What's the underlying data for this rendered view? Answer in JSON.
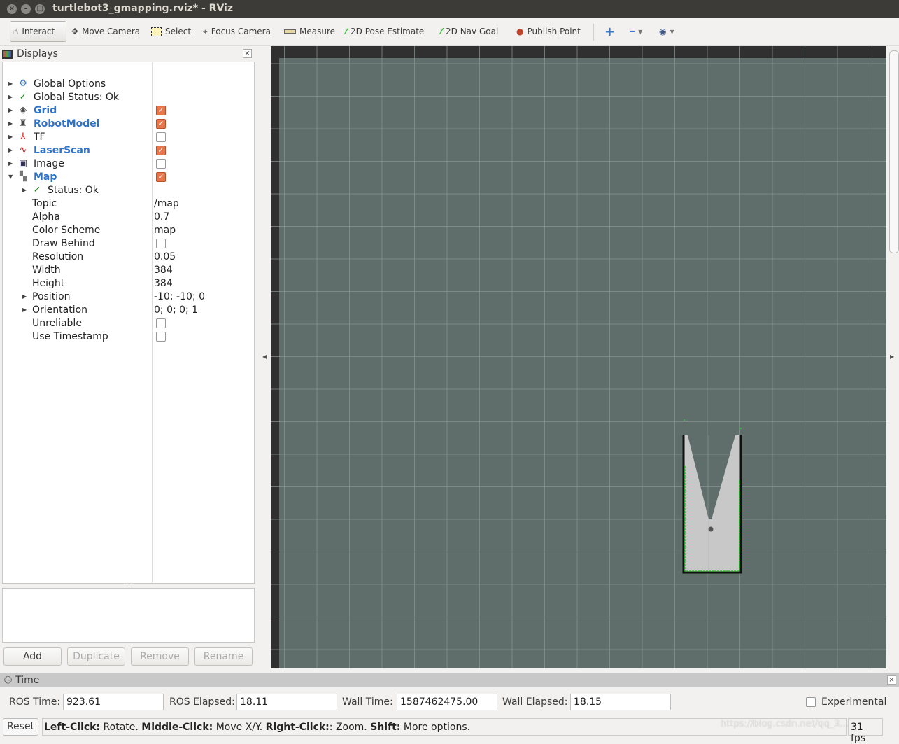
{
  "window": {
    "title": "turtlebot3_gmapping.rviz* - RViz"
  },
  "toolbar": {
    "tools": [
      {
        "label": "Interact",
        "icon": "hand-pointer-icon"
      },
      {
        "label": "Move Camera",
        "icon": "move-arrows-icon"
      },
      {
        "label": "Select",
        "icon": "select-box-icon"
      },
      {
        "label": "Focus Camera",
        "icon": "crosshair-icon"
      },
      {
        "label": "Measure",
        "icon": "ruler-icon"
      },
      {
        "label": "2D Pose Estimate",
        "icon": "green-arrow-icon"
      },
      {
        "label": "2D Nav Goal",
        "icon": "green-arrow-icon"
      },
      {
        "label": "Publish Point",
        "icon": "map-pin-icon"
      }
    ],
    "active": "Interact"
  },
  "displays": {
    "title": "Displays",
    "items": [
      {
        "label": "Global Options",
        "icon": "gear-icon"
      },
      {
        "label": "Global Status: Ok",
        "icon": "check-icon"
      },
      {
        "label": "Grid",
        "icon": "grid-icon",
        "checked": true
      },
      {
        "label": "RobotModel",
        "icon": "robot-icon",
        "checked": true
      },
      {
        "label": "TF",
        "icon": "axes-icon",
        "checked": false
      },
      {
        "label": "LaserScan",
        "icon": "laser-icon",
        "checked": true
      },
      {
        "label": "Image",
        "icon": "image-icon",
        "checked": false
      },
      {
        "label": "Map",
        "icon": "map-icon",
        "checked": true
      }
    ],
    "map_props": [
      {
        "label": "Status: Ok"
      },
      {
        "label": "Topic",
        "value": "/map"
      },
      {
        "label": "Alpha",
        "value": "0.7"
      },
      {
        "label": "Color Scheme",
        "value": "map"
      },
      {
        "label": "Draw Behind",
        "checked": false
      },
      {
        "label": "Resolution",
        "value": "0.05"
      },
      {
        "label": "Width",
        "value": "384"
      },
      {
        "label": "Height",
        "value": "384"
      },
      {
        "label": "Position",
        "value": "-10; -10; 0"
      },
      {
        "label": "Orientation",
        "value": "0; 0; 0; 1"
      },
      {
        "label": "Unreliable",
        "checked": false
      },
      {
        "label": "Use Timestamp",
        "checked": false
      }
    ],
    "buttons": {
      "add": "Add",
      "duplicate": "Duplicate",
      "remove": "Remove",
      "rename": "Rename"
    }
  },
  "time": {
    "title": "Time",
    "ros_time_label": "ROS Time:",
    "ros_time": "923.61",
    "ros_elapsed_label": "ROS Elapsed:",
    "ros_elapsed": "18.11",
    "wall_time_label": "Wall Time:",
    "wall_time": "1587462475.00",
    "wall_elapsed_label": "Wall Elapsed:",
    "wall_elapsed": "18.15",
    "experimental": "Experimental"
  },
  "statusbar": {
    "reset": "Reset",
    "hint": [
      [
        "Left-Click:",
        " Rotate. "
      ],
      [
        "Middle-Click:",
        " Move X/Y. "
      ],
      [
        "Right-Click:",
        ": Zoom. "
      ],
      [
        "Shift:",
        " More options."
      ]
    ],
    "fps": "31 fps",
    "watermark": "https://blog.csdn.net/qq_3..."
  },
  "colors": {
    "view_bg": "#5f6e6b",
    "grid": "#8a9794",
    "free": "#c8c8c8",
    "laser": "#00ff00",
    "checkbox": "#e8764a"
  }
}
